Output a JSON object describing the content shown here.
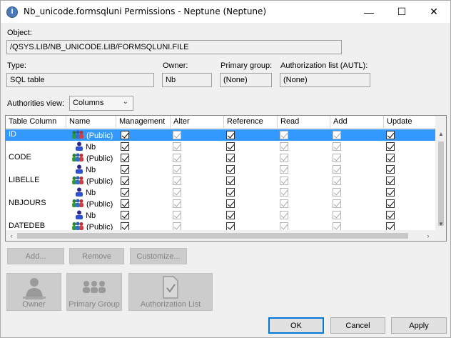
{
  "window": {
    "title": "Nb_unicode.formsqluni Permissions - Neptune (Neptune)",
    "app_icon": "I",
    "min_glyph": "—",
    "max_glyph": "☐",
    "close_glyph": "✕"
  },
  "object": {
    "label": "Object:",
    "value": "/QSYS.LIB/NB_UNICODE.LIB/FORMSQLUNI.FILE"
  },
  "type": {
    "label": "Type:",
    "value": "SQL table"
  },
  "owner": {
    "label": "Owner:",
    "value": "Nb"
  },
  "primary_group": {
    "label": "Primary group:",
    "value": "(None)"
  },
  "autl": {
    "label": "Authorization list (AUTL):",
    "value": "(None)"
  },
  "view": {
    "label": "Authorities view:",
    "selected": "Columns"
  },
  "table": {
    "headers": [
      "Table Column",
      "Name",
      "Management",
      "Alter",
      "Reference",
      "Read",
      "Add",
      "Update"
    ],
    "rows": [
      {
        "column": "ID",
        "name": "(Public)",
        "icon": "group-icon",
        "selected": true
      },
      {
        "column": "",
        "name": "Nb",
        "icon": "user-icon",
        "selected": false
      },
      {
        "column": "CODE",
        "name": "(Public)",
        "icon": "group-icon",
        "selected": false
      },
      {
        "column": "",
        "name": "Nb",
        "icon": "user-icon",
        "selected": false
      },
      {
        "column": "LIBELLE",
        "name": "(Public)",
        "icon": "group-icon",
        "selected": false
      },
      {
        "column": "",
        "name": "Nb",
        "icon": "user-icon",
        "selected": false
      },
      {
        "column": "NBJOURS",
        "name": "(Public)",
        "icon": "group-icon",
        "selected": false
      },
      {
        "column": "",
        "name": "Nb",
        "icon": "user-icon",
        "selected": false
      },
      {
        "column": "DATEDEB",
        "name": "(Public)",
        "icon": "group-icon",
        "selected": false
      }
    ]
  },
  "buttons": {
    "add": "Add...",
    "remove": "Remove",
    "customize": "Customize...",
    "owner": "Owner",
    "primary_group": "Primary Group",
    "authorization_list": "Authorization List",
    "ok": "OK",
    "cancel": "Cancel",
    "apply": "Apply"
  },
  "colors": {
    "selection": "#3399ff",
    "accent": "#0078d7"
  }
}
